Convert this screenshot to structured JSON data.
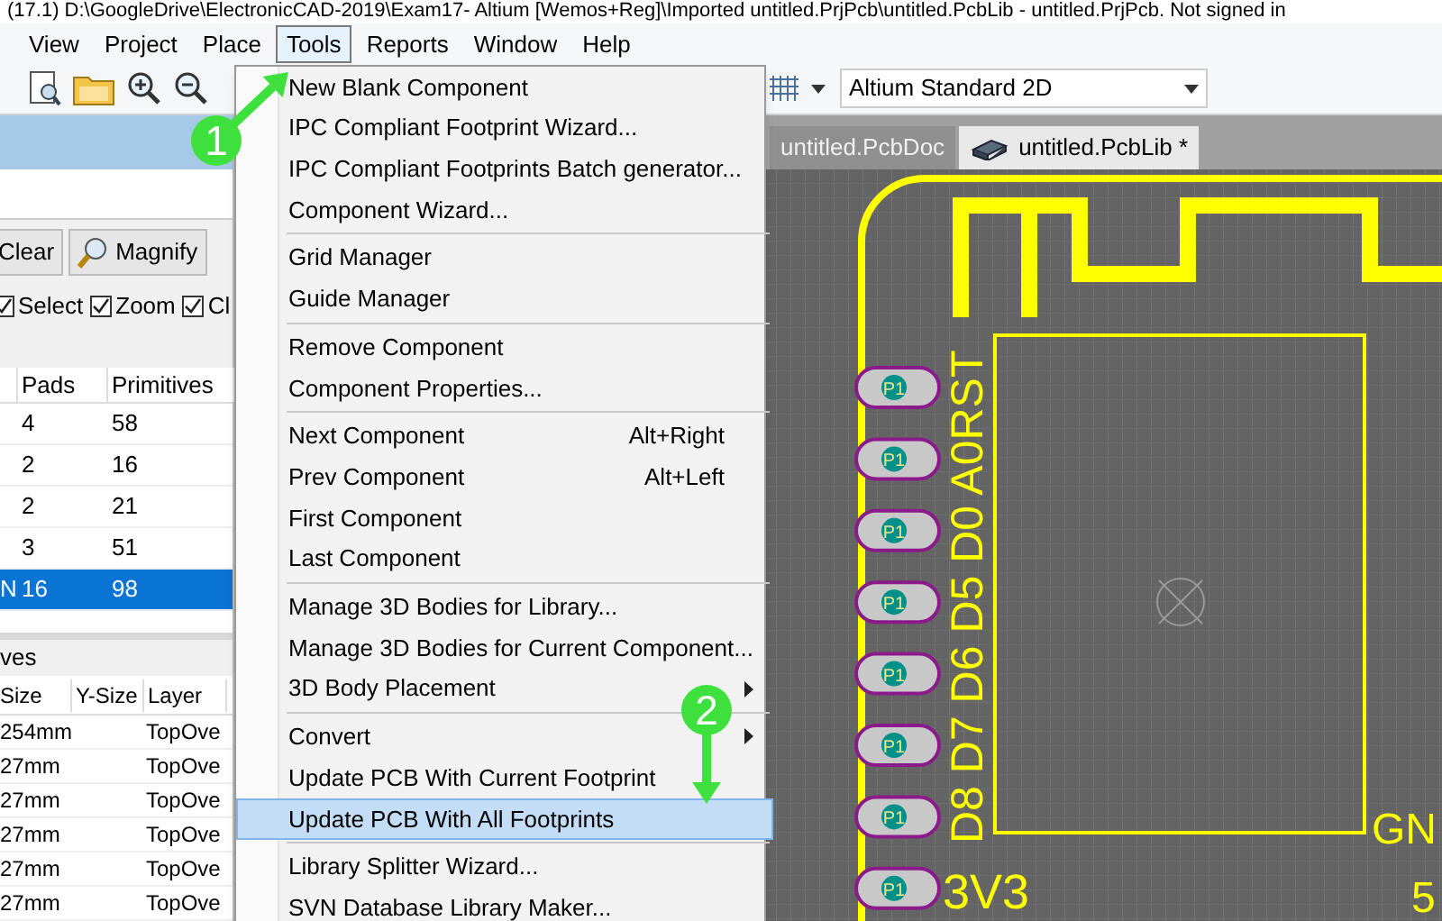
{
  "title_bar": {
    "text": "(17.1)    D:\\GoogleDrive\\ElectronicCAD-2019\\Exam17- Altium [Wemos+Reg]\\Imported untitled.PrjPcb\\untitled.PcbLib  -  untitled.PrjPcb. Not signed in"
  },
  "menu_bar": [
    {
      "label": "View",
      "selected": false
    },
    {
      "label": "Project",
      "selected": false
    },
    {
      "label": "Place",
      "selected": false
    },
    {
      "label": "Tools",
      "selected": true
    },
    {
      "label": "Reports",
      "selected": false
    },
    {
      "label": "Window",
      "selected": false
    },
    {
      "label": "Help",
      "selected": false
    }
  ],
  "toolbar": {
    "view_mode": "Altium Standard 2D"
  },
  "left_panel": {
    "buttons": [
      "Clear",
      "Magnify"
    ],
    "checkboxes": [
      {
        "label": "Select",
        "checked": true
      },
      {
        "label": "Zoom",
        "checked": true
      },
      {
        "label": "Cl",
        "checked": true
      }
    ],
    "components": {
      "columns": [
        "Pads",
        "Primitives"
      ],
      "rows": [
        {
          "cells": [
            "4",
            "58"
          ],
          "selected": false
        },
        {
          "cells": [
            "2",
            "16"
          ],
          "selected": false
        },
        {
          "cells": [
            "2",
            "21"
          ],
          "selected": false
        },
        {
          "cells": [
            "3",
            "51"
          ],
          "selected": false
        },
        {
          "lead": "N",
          "cells": [
            "16",
            "98"
          ],
          "selected": true
        }
      ]
    },
    "primitives": {
      "title": "ves",
      "columns": [
        "Size",
        "Y-Size",
        "Layer"
      ],
      "rows": [
        [
          "254mm",
          "TopOve"
        ],
        [
          "27mm",
          "TopOve"
        ],
        [
          "27mm",
          "TopOve"
        ],
        [
          "27mm",
          "TopOve"
        ],
        [
          "27mm",
          "TopOve"
        ],
        [
          "27mm",
          "TopOve"
        ]
      ]
    }
  },
  "menu": {
    "items": [
      {
        "label": "New Blank Component",
        "selected": false,
        "separator_before": false
      },
      {
        "label": "IPC Compliant Footprint Wizard...",
        "selected": false,
        "separator_before": false
      },
      {
        "label": "IPC Compliant Footprints Batch generator...",
        "selected": false,
        "separator_before": false
      },
      {
        "label": "Component Wizard...",
        "selected": false,
        "separator_before": false
      },
      {
        "label": "Grid Manager",
        "selected": false,
        "separator_before": true
      },
      {
        "label": "Guide Manager",
        "selected": false,
        "separator_before": false
      },
      {
        "label": "Remove Component",
        "selected": false,
        "separator_before": true
      },
      {
        "label": "Component Properties...",
        "selected": false,
        "separator_before": false
      },
      {
        "label": "Next Component",
        "shortcut": "Alt+Right",
        "selected": false,
        "separator_before": true
      },
      {
        "label": "Prev Component",
        "shortcut": "Alt+Left",
        "selected": false,
        "separator_before": false
      },
      {
        "label": "First Component",
        "selected": false,
        "separator_before": false
      },
      {
        "label": "Last Component",
        "selected": false,
        "separator_before": false
      },
      {
        "label": "Manage 3D Bodies for Library...",
        "selected": false,
        "separator_before": true
      },
      {
        "label": "Manage 3D Bodies for Current Component...",
        "selected": false,
        "separator_before": false
      },
      {
        "label": "3D Body Placement",
        "submenu": true,
        "selected": false,
        "separator_before": false
      },
      {
        "label": "Convert",
        "submenu": true,
        "selected": false,
        "separator_before": true
      },
      {
        "label": "Update PCB With Current Footprint",
        "selected": false,
        "separator_before": false
      },
      {
        "label": "Update PCB With All Footprints",
        "selected": true,
        "separator_before": false
      },
      {
        "label": "Library Splitter Wizard...",
        "selected": false,
        "separator_before": true
      },
      {
        "label": "SVN Database Library Maker...",
        "selected": false,
        "separator_before": false
      }
    ]
  },
  "doc_tabs": [
    {
      "label": "untitled.PcbDoc",
      "selected": false
    },
    {
      "label": "untitled.PcbLib *",
      "selected": true
    }
  ],
  "canvas": {
    "pads": [
      "P1",
      "P1",
      "P1",
      "P1",
      "P1",
      "P1",
      "P1",
      "P1"
    ],
    "vertical_label": "D8 D7 D6 D5 D0 A0RST",
    "labels": [
      "3V3",
      "GN",
      "5"
    ]
  },
  "callouts": [
    "1",
    "2"
  ]
}
